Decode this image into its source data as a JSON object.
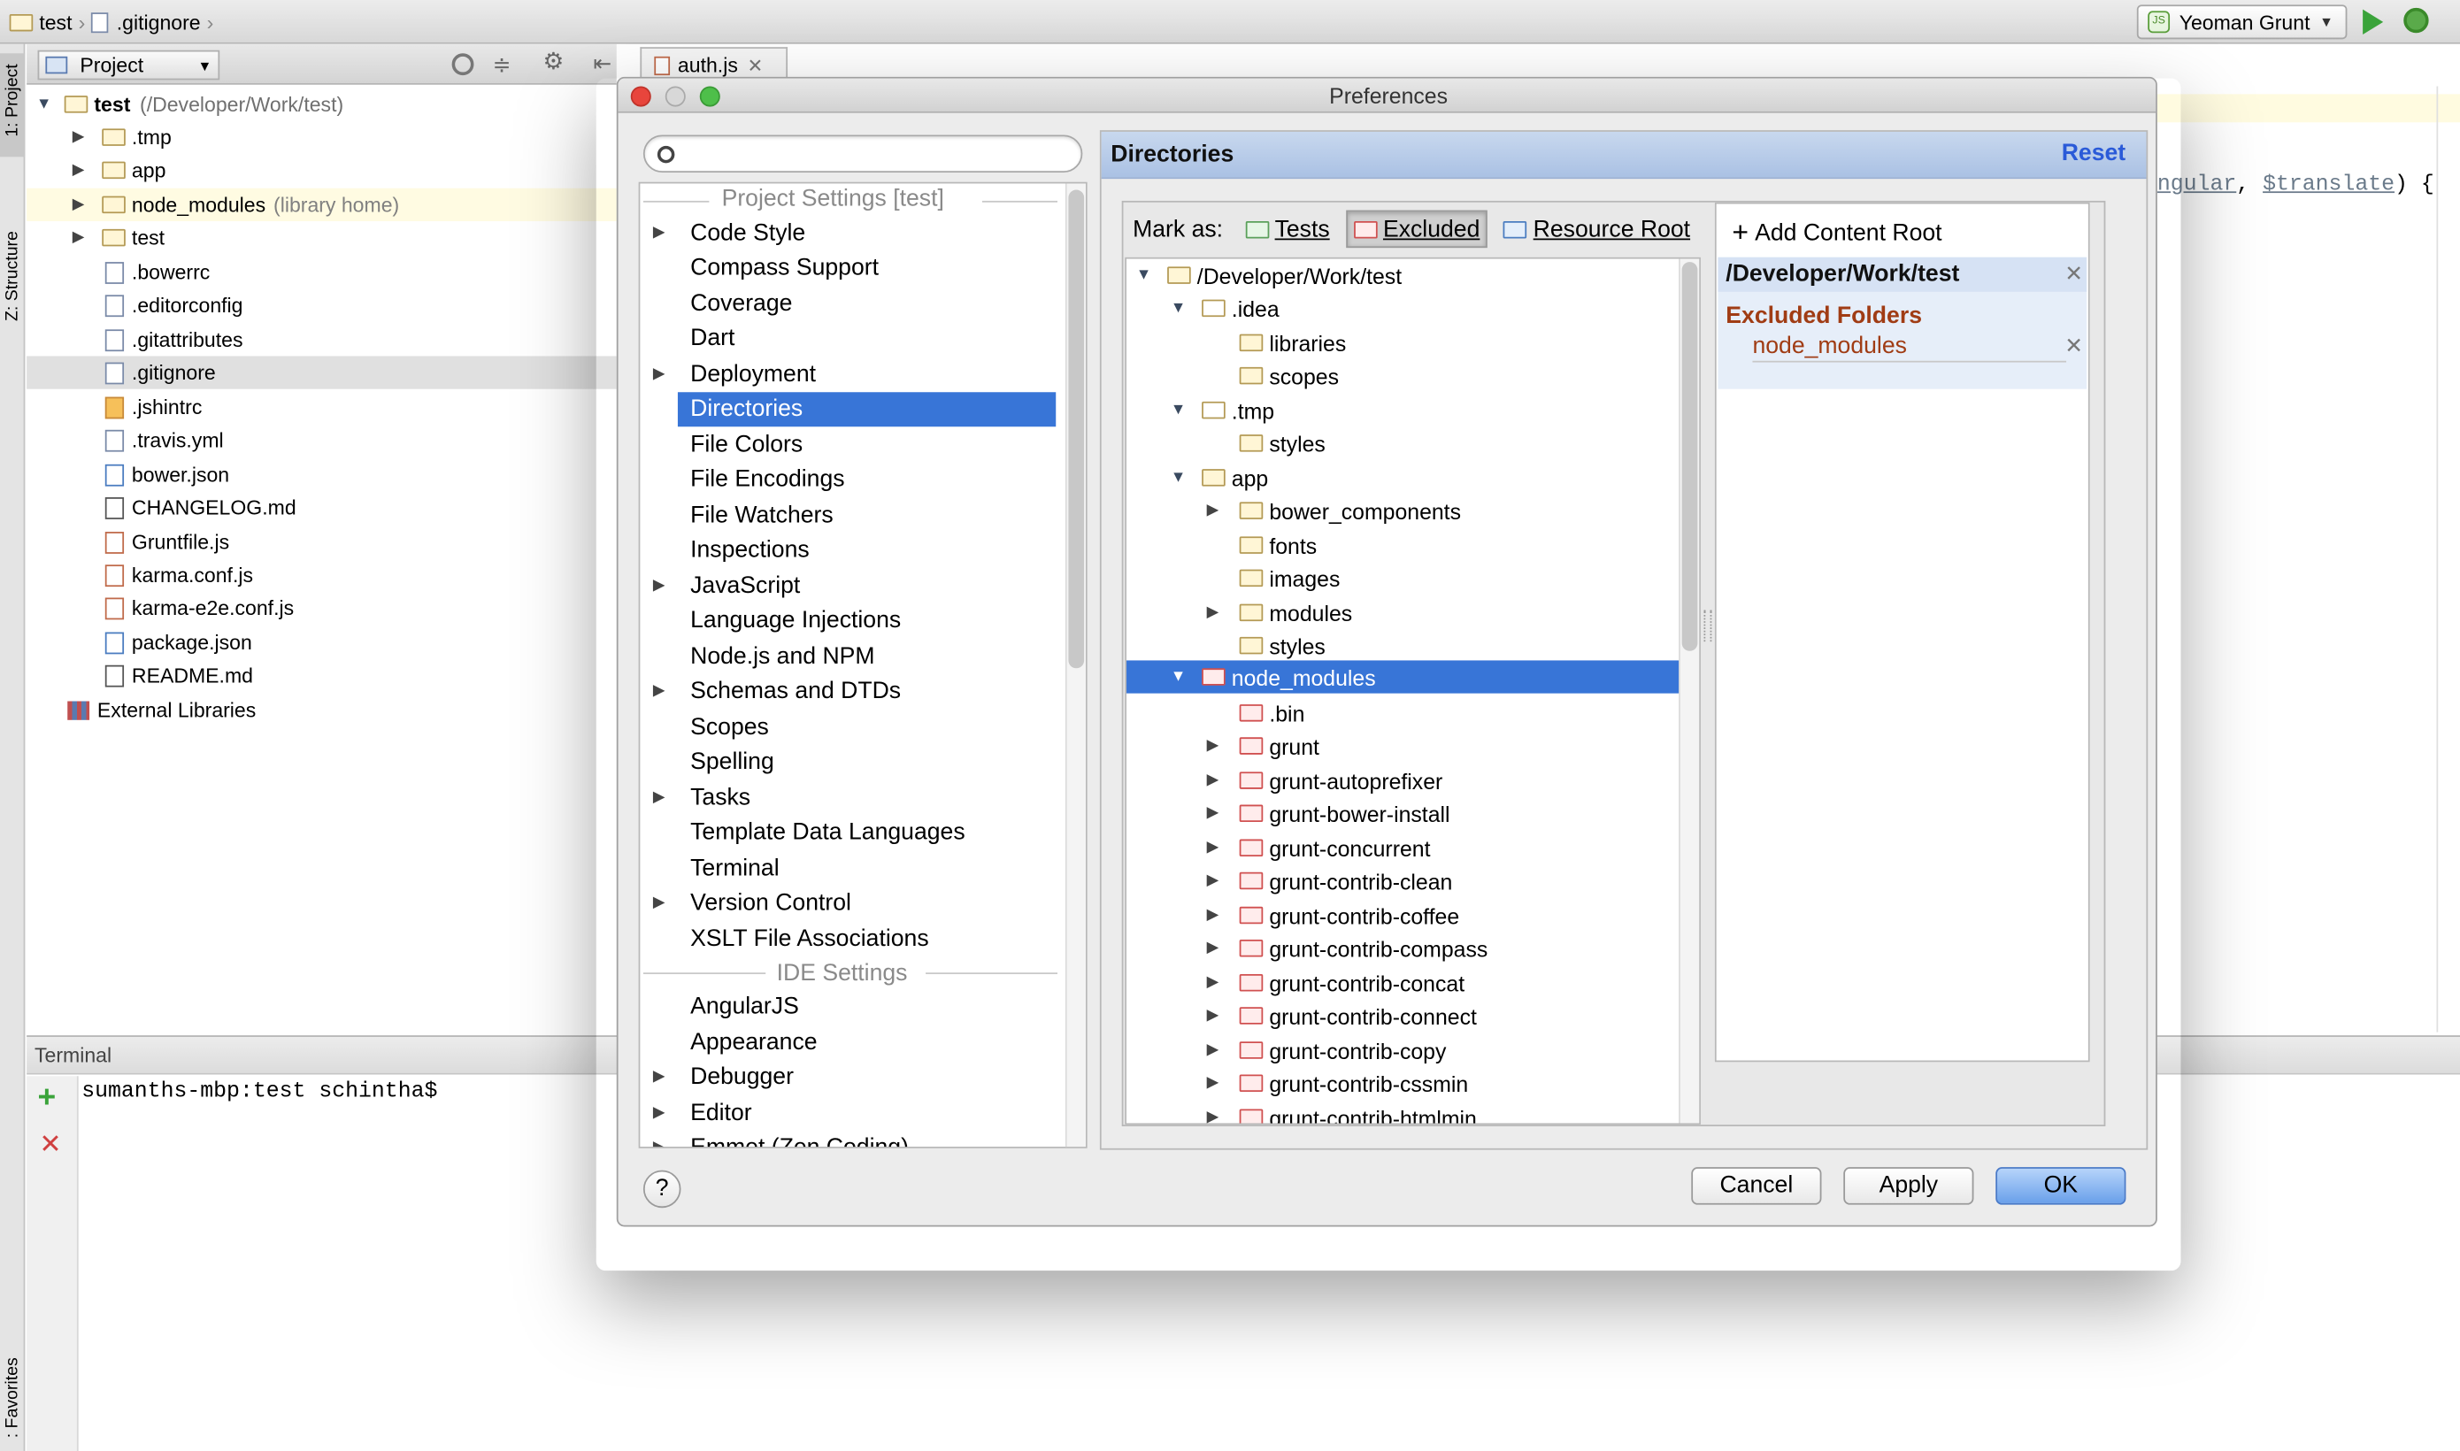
{
  "ide": {
    "breadcrumb": [
      "test",
      ".gitignore"
    ],
    "run_config": "Yeoman Grunt",
    "editor_tab": "auth.js",
    "editor_snippet": {
      "part1": "ngular",
      "sep": ", ",
      "part2": "$translate",
      "end": ") {"
    },
    "project_dropdown": "Project",
    "side_tabs": {
      "project": "1: Project",
      "structure": "Z: Structure",
      "favorites": ": Favorites"
    },
    "terminal_title": "Terminal",
    "terminal_prompt": "sumanths-mbp:test schintha$"
  },
  "project_tree": {
    "root_name": "test",
    "root_path": "(/Developer/Work/test)",
    "node_modules_note": "(library home)",
    "items": [
      ".tmp",
      "app",
      "node_modules",
      "test",
      ".bowerrc",
      ".editorconfig",
      ".gitattributes",
      ".gitignore",
      ".jshintrc",
      ".travis.yml",
      "bower.json",
      "CHANGELOG.md",
      "Gruntfile.js",
      "karma.conf.js",
      "karma-e2e.conf.js",
      "package.json",
      "README.md",
      "External Libraries"
    ]
  },
  "dialog": {
    "title": "Preferences",
    "search_placeholder": "",
    "project_settings_header": "Project Settings [test]",
    "project_settings": [
      "Code Style",
      "Compass Support",
      "Coverage",
      "Dart",
      "Deployment",
      "Directories",
      "File Colors",
      "File Encodings",
      "File Watchers",
      "Inspections",
      "JavaScript",
      "Language Injections",
      "Node.js and NPM",
      "Schemas and DTDs",
      "Scopes",
      "Spelling",
      "Tasks",
      "Template Data Languages",
      "Terminal",
      "Version Control",
      "XSLT File Associations"
    ],
    "ide_settings_header": "IDE Settings",
    "ide_settings": [
      "AngularJS",
      "Appearance",
      "Debugger",
      "Editor",
      "Emmet (Zen Coding)"
    ],
    "panel_title": "Directories",
    "reset": "Reset",
    "mark_as": "Mark as:",
    "mark_tests": "Tests",
    "mark_excluded": "Excluded",
    "mark_resource": "Resource Root",
    "dir_tree": [
      "/Developer/Work/test",
      ".idea",
      "libraries",
      "scopes",
      ".tmp",
      "styles",
      "app",
      "bower_components",
      "fonts",
      "images",
      "modules",
      "styles",
      "node_modules",
      ".bin",
      "grunt",
      "grunt-autoprefixer",
      "grunt-bower-install",
      "grunt-concurrent",
      "grunt-contrib-clean",
      "grunt-contrib-coffee",
      "grunt-contrib-compass",
      "grunt-contrib-concat",
      "grunt-contrib-connect",
      "grunt-contrib-copy",
      "grunt-contrib-cssmin",
      "grunt-contrib-htmlmin"
    ],
    "add_content_root": "Add Content Root",
    "content_root": "/Developer/Work/test",
    "excluded_folders_label": "Excluded Folders",
    "excluded_folder": "node_modules",
    "buttons": {
      "help": "?",
      "cancel": "Cancel",
      "apply": "Apply",
      "ok": "OK"
    }
  },
  "colors": {
    "selection": "#3875d7",
    "excluded": "#a03c14",
    "ok_button": "#8cb8f0",
    "header_bar": "#b8cdeb"
  }
}
